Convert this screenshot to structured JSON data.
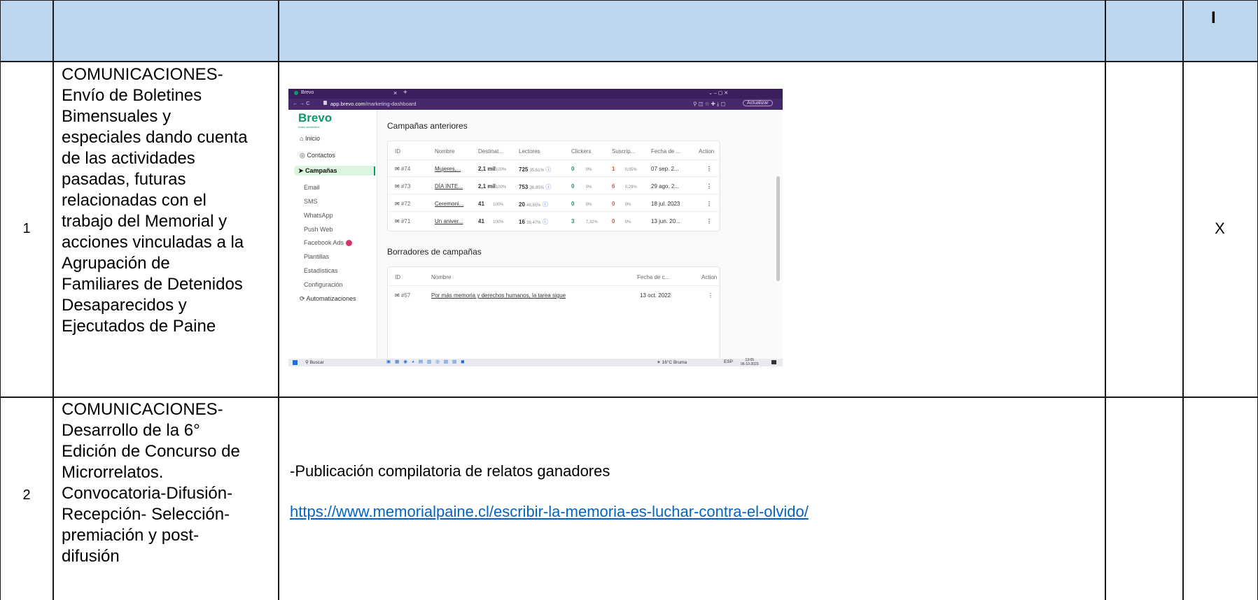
{
  "table": {
    "header": {
      "mark": "I"
    },
    "rows": [
      {
        "number": "1",
        "description_lines": [
          "COMUNICACIONES-",
          "Envío de Boletines",
          "Bimensuales y",
          "especiales dando cuenta",
          "de las actividades",
          "pasadas, futuras",
          "relacionadas con el",
          "trabajo del Memorial y",
          "acciones vinculadas a la",
          "Agrupación de",
          "Familiares de Detenidos",
          "Desaparecidos y",
          "Ejecutados de Paine"
        ],
        "mark": "X"
      },
      {
        "number": "2",
        "description_lines": [
          "COMUNICACIONES-",
          "Desarrollo de la 6°",
          "Edición de Concurso de",
          "Microrrelatos.",
          "Convocatoria-Difusión-",
          "Recepción- Selección-",
          "premiación y post-",
          "difusión"
        ],
        "content_text": "-Publicación compilatoria de relatos ganadores",
        "content_link": "https://www.memorialpaine.cl/escribir-la-memoria-es-luchar-contra-el-olvido/"
      }
    ]
  },
  "screenshot": {
    "tab_title": "Brevo",
    "tab_close": "×",
    "new_tab": "+",
    "window_controls": "⌄   –   ▢   ✕",
    "url_domain": "app.brevo.com",
    "url_path": "/marketing-dashboard",
    "update_button": "Actualizar",
    "brand": "Brevo",
    "brand_sub": "Antes sendinblue",
    "nav": {
      "inicio": "Inicio",
      "contactos": "Contactos",
      "campanas": "Campañas",
      "email": "Email",
      "sms": "SMS",
      "whatsapp": "WhatsApp",
      "pushweb": "Push Web",
      "facebook": "Facebook Ads",
      "plantillas": "Plantillas",
      "estadisticas": "Estadísticas",
      "configuracion": "Configuración",
      "automatizaciones": "Automatizaciones"
    },
    "past_title": "Campañas anteriores",
    "past_columns": [
      "ID",
      "Nombre",
      "Destinat...",
      "Lectores",
      "Clickers",
      "Suscrip...",
      "Fecha de ...",
      "Action"
    ],
    "past_rows": [
      {
        "id": "#74",
        "name": "Mujeres,...",
        "dest": "2,1 mil",
        "dest_pct": "100%",
        "readers": "725",
        "readers_pct": "35,61%",
        "clickers": "0",
        "clickers_pct": "0%",
        "subs": "1",
        "subs_pct": "0,05%",
        "date": "07 sep. 2..."
      },
      {
        "id": "#73",
        "name": "DÍA INTE...",
        "dest": "2,1 mil",
        "dest_pct": "100%",
        "readers": "753",
        "readers_pct": "36,95%",
        "clickers": "0",
        "clickers_pct": "0%",
        "subs": "6",
        "subs_pct": "0,29%",
        "date": "29 ago. 2..."
      },
      {
        "id": "#72",
        "name": "Ceremoni...",
        "dest": "41",
        "dest_pct": "100%",
        "readers": "20",
        "readers_pct": "48,65%",
        "clickers": "0",
        "clickers_pct": "0%",
        "subs": "0",
        "subs_pct": "0%",
        "date": "18 jul. 2023"
      },
      {
        "id": "#71",
        "name": "Un aniver...",
        "dest": "41",
        "dest_pct": "100%",
        "readers": "16",
        "readers_pct": "39,47%",
        "clickers": "3",
        "clickers_pct": "7,32%",
        "subs": "0",
        "subs_pct": "0%",
        "date": "13 jun. 20..."
      }
    ],
    "drafts_title": "Borradores de campañas",
    "draft_columns": [
      "ID",
      "Nombre",
      "Fecha de c...",
      "Action"
    ],
    "draft_rows": [
      {
        "id": "#57",
        "name": "Por más memoria y derechos humanos, la tarea sigue",
        "date": "13 oct. 2022"
      }
    ],
    "taskbar": {
      "search": "Buscar",
      "weather": "16°C Bruma",
      "lang": "ESP",
      "time": "13:05",
      "date": "06-10-2023"
    },
    "colors": {
      "brand_purple": "#3b1f5c",
      "brand_green": "#0b996e",
      "campaign_active": "#dcf5df",
      "red_value": "#e0523a"
    }
  }
}
